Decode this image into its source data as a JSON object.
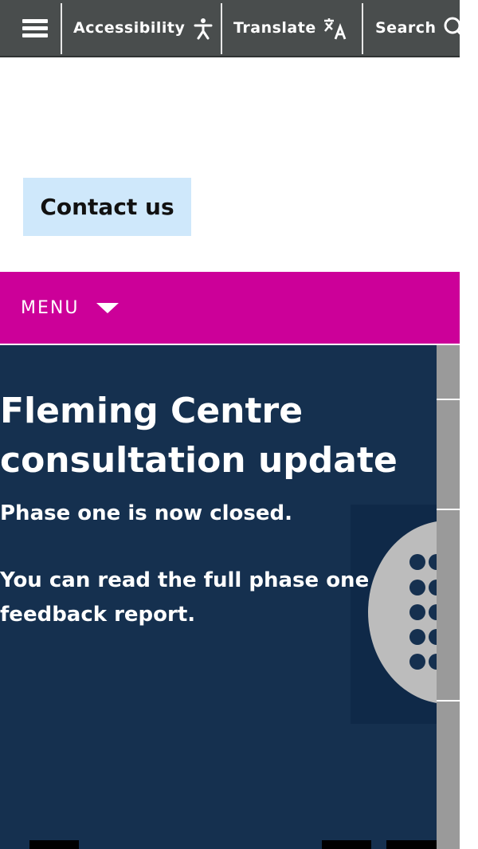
{
  "topbar": {
    "accessibility_label": "Accessibility",
    "translate_label": "Translate",
    "search_label": "Search"
  },
  "contact": {
    "label": "Contact us"
  },
  "menu": {
    "label": "MENU"
  },
  "hero": {
    "title": "Fleming Centre consultation update",
    "paragraph1": "Phase one is now closed.",
    "paragraph2": "You can read the full phase one feedback report."
  },
  "colors": {
    "topbar": "#494d4d",
    "menubar": "#cc0099",
    "hero": "#15304f",
    "contact_button": "#cfe8fb"
  },
  "icons": [
    "menu-icon",
    "accessibility-icon",
    "translate-icon",
    "search-icon",
    "caret-down-icon"
  ]
}
